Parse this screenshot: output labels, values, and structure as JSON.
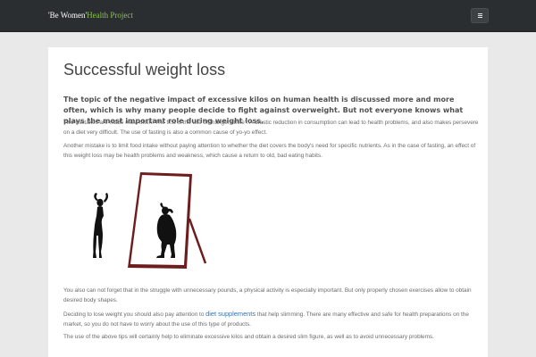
{
  "navbar": {
    "brand_quote": "'Be Women'",
    "brand_accent": "Health Project",
    "menu_icon": "hamburger-menu-icon",
    "background_color": "#2b2e31",
    "accent_color": "#8cc152"
  },
  "article": {
    "title": "Successful weight loss",
    "lead": "The topic of the negative impact of excessive kilos on human health is discussed more and more often, which is why many people decide to fight against overweight. But not everyone knows what plays the most important role during weight loss.",
    "p1": "Two mistakes are made most often. The first is the use of \"hunger strike\". A drastic reduction in consumption can lead to health problems, and also makes persevere on a diet very difficult. The use of fasting is also a common cause of yo-yo effect.",
    "p2": "Another mistake is to limit food intake without paying attention to whether the diet covers the body's need for specific nutrients. As in the case of fasting, an effect of this weight loss may be health problems and weakness, which cause a return to old, bad eating habits.",
    "illustration": "woman-mirror-silhouette",
    "p3": "You also can not forget that in the struggle with unnecessary pounds, a physical activity is especially important. But only properly chosen exercises allow to obtain desired body shapes.",
    "p4_before": "Deciding to lose weight you should also pay attention to ",
    "p4_link": "diet supplements",
    "p4_after": " that help slimming. There are many effective and safe for health preparations on the market, so you do not have to worry about the use of this type of products.",
    "p5": "The use of the above tips will certainly help to eliminate excessive kilos and obtain a desired slim figure, as well as to avoid unnecessary problems.",
    "link_color": "#2a75b8"
  }
}
